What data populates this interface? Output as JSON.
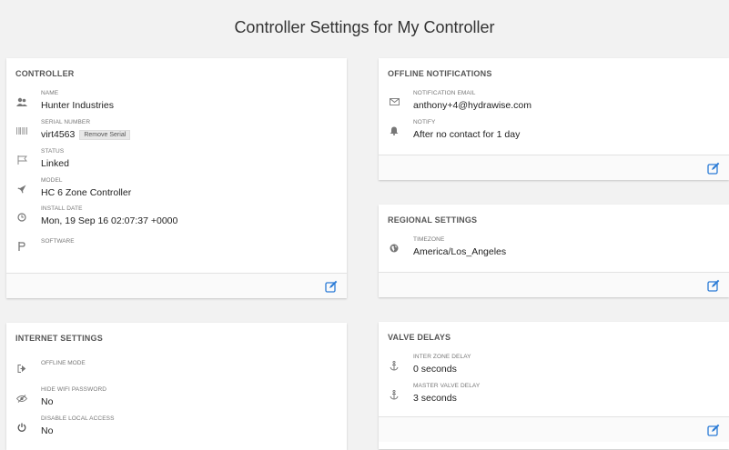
{
  "page": {
    "title": "Controller Settings for My Controller"
  },
  "controller": {
    "title": "CONTROLLER",
    "fields": [
      {
        "label": "NAME",
        "value": "Hunter Industries",
        "icon": "group-icon"
      },
      {
        "label": "SERIAL NUMBER",
        "value": "virt4563",
        "icon": "barcode-icon",
        "action": "Remove Serial"
      },
      {
        "label": "STATUS",
        "value": "Linked",
        "icon": "flag-icon"
      },
      {
        "label": "MODEL",
        "value": "HC 6 Zone Controller",
        "icon": "rocket-icon"
      },
      {
        "label": "INSTALL DATE",
        "value": "Mon, 19 Sep 16 02:07:37 +0000",
        "icon": "clock-icon"
      },
      {
        "label": "SOFTWARE",
        "value": "",
        "icon": "software-icon"
      }
    ]
  },
  "offline": {
    "title": "OFFLINE NOTIFICATIONS",
    "fields": [
      {
        "label": "NOTIFICATION EMAIL",
        "value": "anthony+4@hydrawise.com",
        "icon": "envelope-icon"
      },
      {
        "label": "NOTIFY",
        "value": "After no contact for 1 day",
        "icon": "bell-icon"
      }
    ]
  },
  "regional": {
    "title": "REGIONAL SETTINGS",
    "fields": [
      {
        "label": "TIMEZONE",
        "value": "America/Los_Angeles",
        "icon": "globe-icon"
      }
    ]
  },
  "internet": {
    "title": "INTERNET SETTINGS",
    "fields": [
      {
        "label": "OFFLINE MODE",
        "value": "",
        "icon": "sign-out-icon"
      },
      {
        "label": "HIDE WIFI PASSWORD",
        "value": "No",
        "icon": "eye-slash-icon"
      },
      {
        "label": "DISABLE LOCAL ACCESS",
        "value": "No",
        "icon": "power-icon"
      }
    ]
  },
  "valve": {
    "title": "VALVE DELAYS",
    "fields": [
      {
        "label": "INTER ZONE DELAY",
        "value": "0 seconds",
        "icon": "anchor-icon"
      },
      {
        "label": "MASTER VALVE DELAY",
        "value": "3 seconds",
        "icon": "anchor-icon"
      }
    ]
  },
  "colors": {
    "accent": "#2a7bd6",
    "icon": "#777777",
    "background": "#f2f2f2"
  }
}
